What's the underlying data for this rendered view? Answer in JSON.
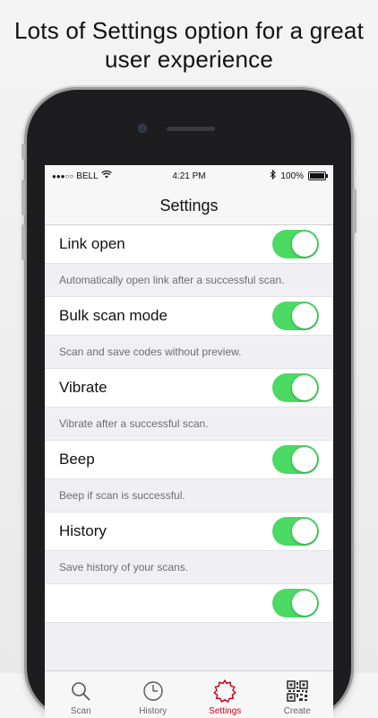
{
  "headline": {
    "line1": "Lots of Settings option for a great",
    "line2": "user experience"
  },
  "statusbar": {
    "carrier": "BELL",
    "time": "4:21 PM",
    "battery": "100%"
  },
  "navbar": {
    "title": "Settings"
  },
  "settings": [
    {
      "label": "Link open",
      "enabled": true,
      "description": "Automatically open link after a successful scan."
    },
    {
      "label": "Bulk scan mode",
      "enabled": true,
      "description": "Scan and save codes without preview."
    },
    {
      "label": "Vibrate",
      "enabled": true,
      "description": "Vibrate after a successful scan."
    },
    {
      "label": "Beep",
      "enabled": true,
      "description": "Beep if scan is successful."
    },
    {
      "label": "History",
      "enabled": true,
      "description": "Save history of your scans."
    }
  ],
  "tabs": [
    {
      "label": "Scan",
      "icon": "magnifier-icon"
    },
    {
      "label": "History",
      "icon": "clock-icon"
    },
    {
      "label": "Settings",
      "icon": "gear-icon",
      "active": true
    },
    {
      "label": "Create",
      "icon": "qr-code-icon"
    }
  ],
  "colors": {
    "toggle_on": "#4cd964",
    "active_tab": "#d0021b"
  }
}
